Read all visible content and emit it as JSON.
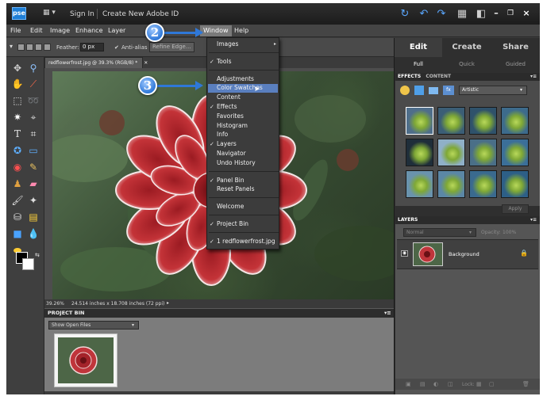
{
  "titlebar": {
    "logo": "pse",
    "sign_in": "Sign In",
    "create_id": "Create New Adobe ID",
    "icons": [
      "undo-circle-icon",
      "undo-icon",
      "redo-icon",
      "grid-icon",
      "workspace-icon"
    ],
    "window_controls": [
      "minimize",
      "restore",
      "close"
    ]
  },
  "menubar": [
    "File",
    "Edit",
    "Image",
    "Enhance",
    "Layer",
    "Window",
    "Help"
  ],
  "options_bar": {
    "feather_label": "Feather:",
    "feather_value": "0 px",
    "anti_alias_label": "Anti-alias",
    "refine_edge_label": "Refine Edge..."
  },
  "document": {
    "tab_title": "redflowerfrost.jpg @ 39.3% (RGB/8) *",
    "zoom": "39.26%",
    "size": "24.514 inches x 18.708 inches (72 ppi)"
  },
  "window_menu": {
    "items": [
      {
        "label": "Images",
        "checked": false,
        "submenu": true
      },
      {
        "label": "Tools",
        "checked": true
      },
      {
        "label": "Adjustments",
        "checked": false
      },
      {
        "label": "Color Swatches",
        "checked": false,
        "highlighted": true
      },
      {
        "label": "Content",
        "checked": false
      },
      {
        "label": "Effects",
        "checked": true
      },
      {
        "label": "Favorites",
        "checked": false
      },
      {
        "label": "Histogram",
        "checked": false
      },
      {
        "label": "Info",
        "checked": false
      },
      {
        "label": "Layers",
        "checked": true
      },
      {
        "label": "Navigator",
        "checked": false
      },
      {
        "label": "Undo History",
        "checked": false
      },
      {
        "label": "Panel Bin",
        "checked": true
      },
      {
        "label": "Reset Panels",
        "checked": false
      },
      {
        "label": "Welcome",
        "checked": false
      },
      {
        "label": "Project Bin",
        "checked": true
      },
      {
        "label": "1 redflowerfrost.jpg",
        "checked": true
      }
    ]
  },
  "callouts": [
    "2",
    "3"
  ],
  "project_bin": {
    "title": "PROJECT BIN",
    "filter": "Show Open Files"
  },
  "right_panel": {
    "tabs": [
      "Edit",
      "Create",
      "Share"
    ],
    "subtabs": [
      "Full",
      "Quick",
      "Guided"
    ],
    "effects_tabs": [
      "EFFECTS",
      "CONTENT"
    ],
    "effects_filter": "Artistic",
    "apply_label": "Apply",
    "layers_title": "LAYERS",
    "blend_mode": "Normal",
    "opacity_label": "Opacity:",
    "opacity_value": "100%",
    "layer_name": "Background",
    "lock_label": "Lock:"
  },
  "colors": {
    "accent": "#2f78d8",
    "menu_highlight": "#5a7fbf",
    "panel_dark": "#2f2f2f"
  }
}
